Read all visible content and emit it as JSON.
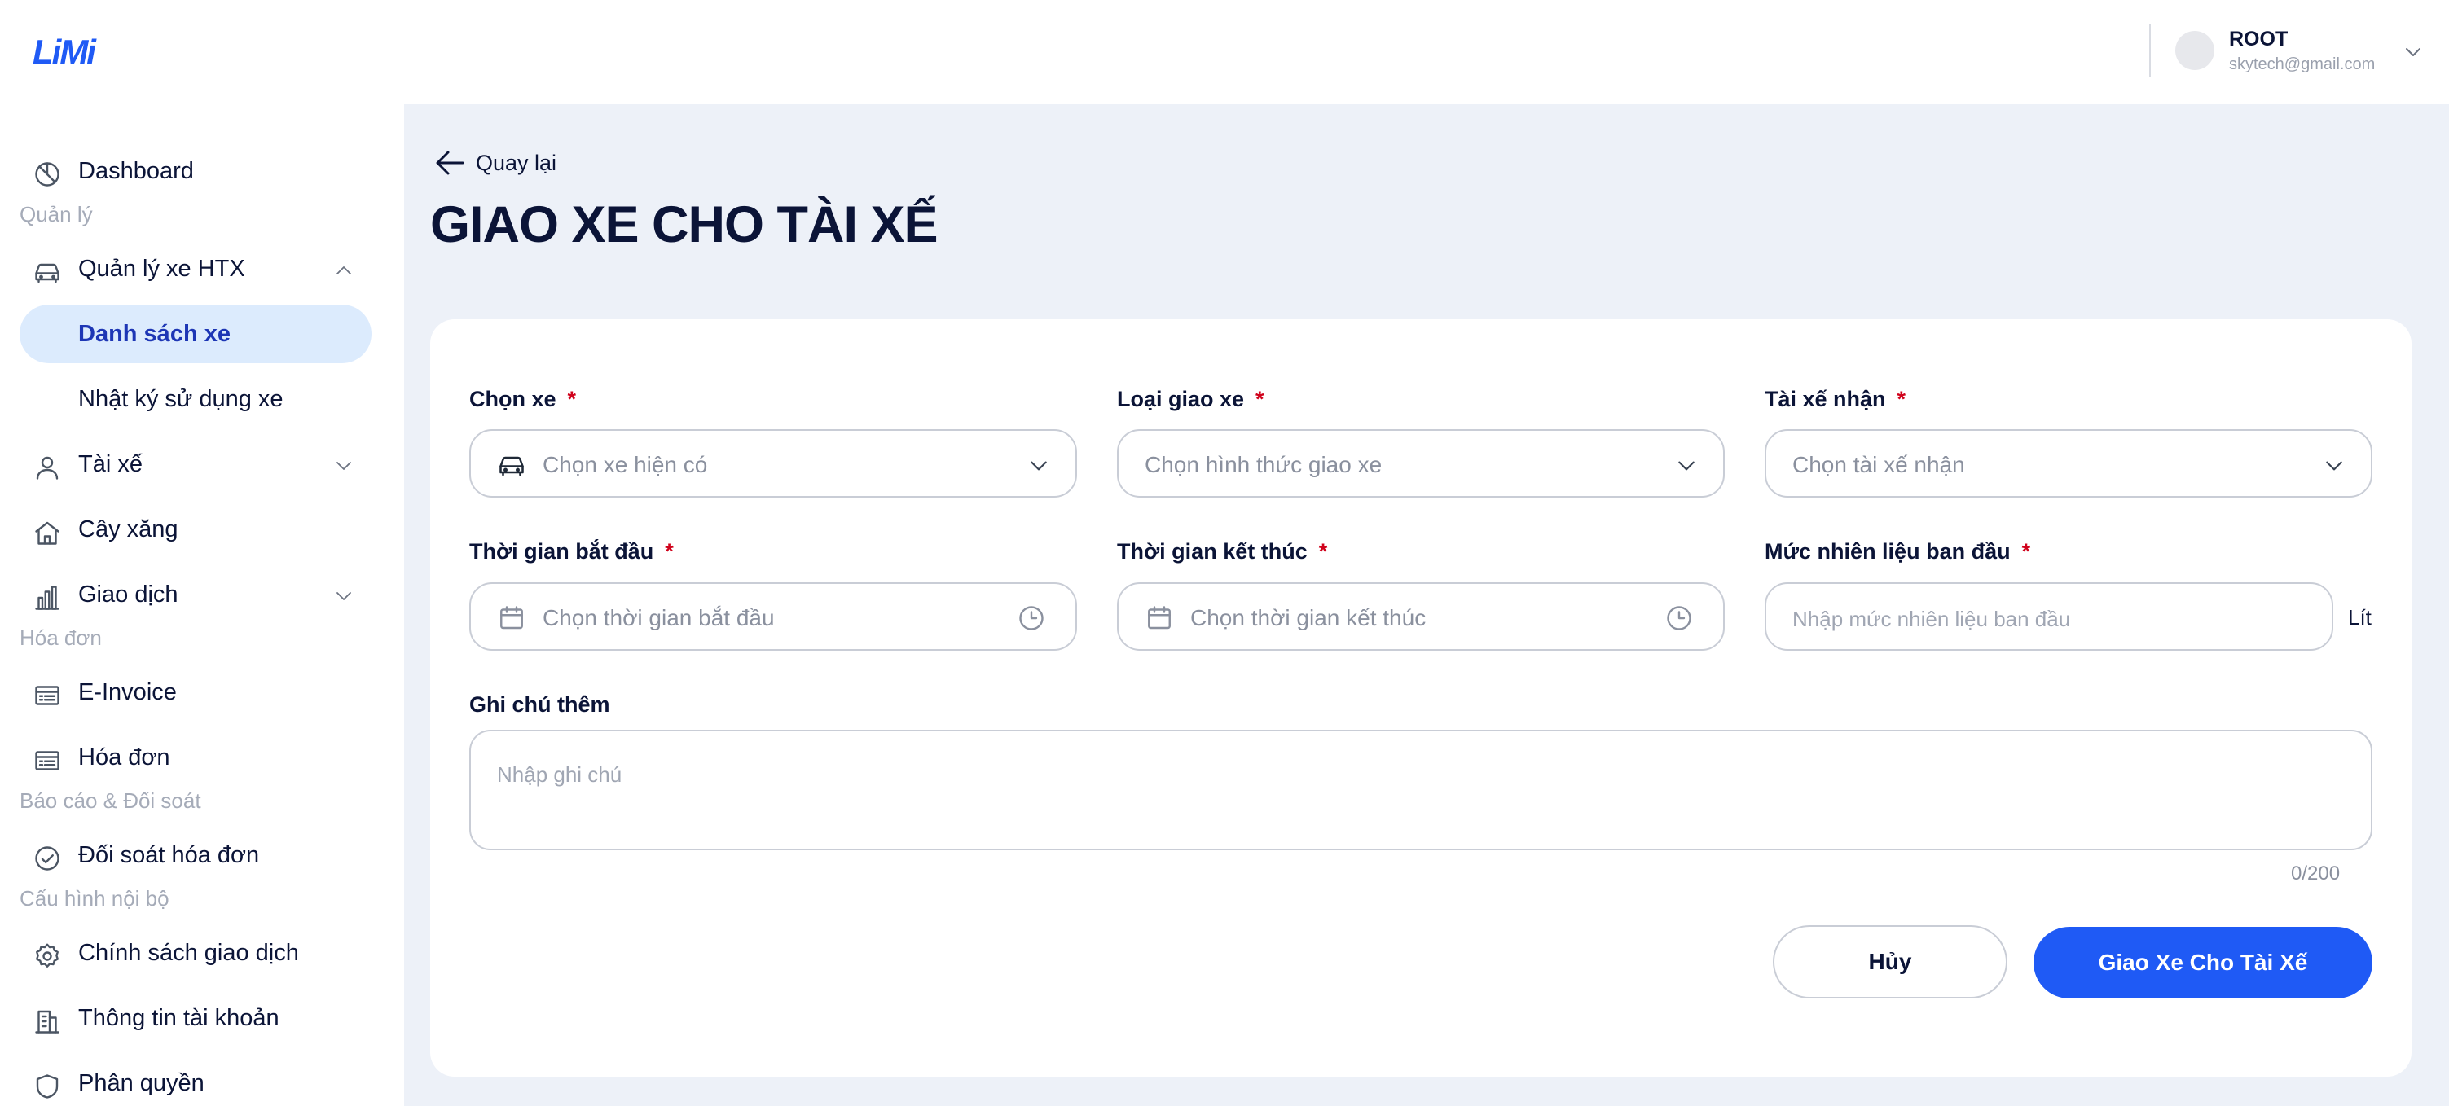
{
  "app": {
    "logo_text": "LiMi"
  },
  "user": {
    "name": "ROOT",
    "email": "skytech@gmail.com"
  },
  "sidebar": {
    "items": [
      {
        "label": "Dashboard",
        "icon": "pie-chart-icon"
      },
      {
        "section": "Quản lý"
      },
      {
        "label": "Quản lý xe HTX",
        "icon": "car-icon",
        "expanded": true
      },
      {
        "label": "Danh sách xe",
        "active": true
      },
      {
        "label": "Nhật ký sử dụng xe"
      },
      {
        "label": "Tài xế",
        "icon": "user-icon"
      },
      {
        "label": "Cây xăng",
        "icon": "home-icon"
      },
      {
        "label": "Giao dịch",
        "icon": "bar-chart-icon"
      },
      {
        "section": "Hóa đơn"
      },
      {
        "label": "E-Invoice",
        "icon": "invoice-icon"
      },
      {
        "label": "Hóa đơn",
        "icon": "invoice-icon"
      },
      {
        "section": "Báo cáo & Đối soát"
      },
      {
        "label": "Đối soát hóa đơn",
        "icon": "check-circle-icon"
      },
      {
        "section": "Cấu hình nội bộ"
      },
      {
        "label": "Chính sách giao dịch",
        "icon": "gear-icon"
      },
      {
        "label": "Thông tin tài khoản",
        "icon": "building-icon"
      },
      {
        "label": "Phân quyền",
        "icon": "shield-icon"
      }
    ]
  },
  "page": {
    "back_label": "Quay lại",
    "title": "GIAO XE CHO TÀI XẾ"
  },
  "form": {
    "required_mark": "*",
    "vehicle": {
      "label": "Chọn xe",
      "placeholder": "Chọn xe hiện có"
    },
    "handover_type": {
      "label": "Loại giao xe",
      "placeholder": "Chọn hình thức giao xe"
    },
    "driver": {
      "label": "Tài xế nhận",
      "placeholder": "Chọn tài xế nhận"
    },
    "start_time": {
      "label": "Thời gian bắt đầu",
      "placeholder": "Chọn thời gian bắt đầu"
    },
    "end_time": {
      "label": "Thời gian kết thúc",
      "placeholder": "Chọn thời gian kết thúc"
    },
    "fuel": {
      "label": "Mức nhiên liệu ban đầu",
      "placeholder": "Nhập mức nhiên liệu ban đầu",
      "unit": "Lít"
    },
    "note": {
      "label": "Ghi chú thêm",
      "placeholder": "Nhập ghi chú",
      "counter": "0/200"
    },
    "cancel_label": "Hủy",
    "submit_label": "Giao Xe Cho Tài Xế"
  },
  "colors": {
    "accent": "#1f5af5",
    "active_bg": "#dcebfd",
    "required": "#d0021b",
    "main_bg": "#edf1f8"
  }
}
